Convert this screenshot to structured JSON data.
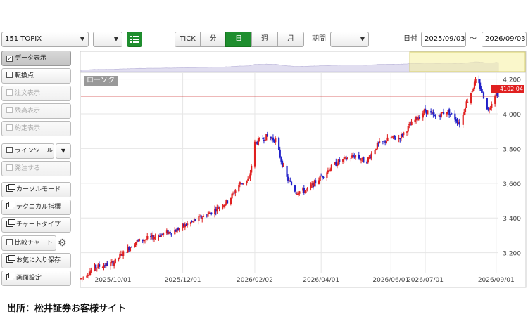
{
  "toolbar": {
    "symbol_value": "151 TOPIX",
    "secondary_select_value": "",
    "list_icon": "list-icon",
    "interval_buttons": [
      "TICK",
      "分",
      "日",
      "週",
      "月"
    ],
    "active_interval": "日",
    "period_label": "期間",
    "period_value": "",
    "date_label": "日付",
    "date_from": "2025/09/03",
    "date_separator": "～",
    "date_to": "2026/09/03"
  },
  "sidebar": {
    "items": [
      {
        "label": "データ表示",
        "kind": "check",
        "checked": true,
        "enabled": true
      },
      {
        "label": "転換点",
        "kind": "check",
        "checked": false,
        "enabled": true
      },
      {
        "label": "注文表示",
        "kind": "check",
        "checked": false,
        "enabled": false
      },
      {
        "label": "残高表示",
        "kind": "check",
        "checked": false,
        "enabled": false
      },
      {
        "label": "約定表示",
        "kind": "check",
        "checked": false,
        "enabled": false
      },
      {
        "label": "ラインツール",
        "kind": "check-dropdown",
        "checked": false,
        "enabled": true
      },
      {
        "label": "発注する",
        "kind": "check",
        "checked": false,
        "enabled": false
      },
      {
        "label": "カーソルモード",
        "kind": "window",
        "enabled": true
      },
      {
        "label": "テクニカル指標",
        "kind": "window",
        "enabled": true
      },
      {
        "label": "チャートタイプ",
        "kind": "window",
        "enabled": true
      },
      {
        "label": "比較チャート",
        "kind": "check-gear",
        "checked": false,
        "enabled": true
      },
      {
        "label": "お気に入り保存",
        "kind": "window",
        "enabled": true
      },
      {
        "label": "画面設定",
        "kind": "window",
        "enabled": true
      }
    ]
  },
  "chart_label": "ローソク",
  "current_price_label": "4102.04",
  "colors": {
    "up": "#e02020",
    "down": "#2020c8",
    "price_line": "#d04040",
    "price_tag": "#e02020",
    "active": "#1e8e2e"
  },
  "caption": "出所：松井証券お客様サイト",
  "chart_data": {
    "type": "candlestick",
    "xlabels": [
      "2025/10/01",
      "2025/12/01",
      "2026/02/02",
      "2026/04/01",
      "2026/06/01",
      "2026/07/01",
      "2026/09/01"
    ],
    "xlabel_dates": [
      "2025-10-01",
      "2025-12-01",
      "2026-02-02",
      "2026-04-01",
      "2026-06-01",
      "2026-07-01",
      "2026-09-01"
    ],
    "x_range": [
      "2025-09-03",
      "2026-09-03"
    ],
    "yticks": [
      3200,
      3400,
      3600,
      3800,
      4000,
      4200
    ],
    "ylim": [
      3085,
      4235
    ],
    "current_price": 4102.04,
    "grid": true,
    "anchors": [
      [
        "2025-09-03",
        3050
      ],
      [
        "2025-09-15",
        3115
      ],
      [
        "2025-10-01",
        3140
      ],
      [
        "2025-10-20",
        3260
      ],
      [
        "2025-11-05",
        3290
      ],
      [
        "2025-11-25",
        3330
      ],
      [
        "2025-12-10",
        3380
      ],
      [
        "2025-12-25",
        3430
      ],
      [
        "2026-01-10",
        3500
      ],
      [
        "2026-01-20",
        3600
      ],
      [
        "2026-01-28",
        3620
      ],
      [
        "2026-02-02",
        3830
      ],
      [
        "2026-02-12",
        3870
      ],
      [
        "2026-02-20",
        3850
      ],
      [
        "2026-03-01",
        3640
      ],
      [
        "2026-03-10",
        3550
      ],
      [
        "2026-03-20",
        3560
      ],
      [
        "2026-04-01",
        3640
      ],
      [
        "2026-04-15",
        3720
      ],
      [
        "2026-05-01",
        3760
      ],
      [
        "2026-05-10",
        3720
      ],
      [
        "2026-05-20",
        3820
      ],
      [
        "2026-06-01",
        3860
      ],
      [
        "2026-06-08",
        3860
      ],
      [
        "2026-06-20",
        3950
      ],
      [
        "2026-07-01",
        4020
      ],
      [
        "2026-07-10",
        3980
      ],
      [
        "2026-07-20",
        4020
      ],
      [
        "2026-08-01",
        3940
      ],
      [
        "2026-08-05",
        4050
      ],
      [
        "2026-08-15",
        4200
      ],
      [
        "2026-08-20",
        4120
      ],
      [
        "2026-08-25",
        4020
      ],
      [
        "2026-09-01",
        4130
      ],
      [
        "2026-09-03",
        4102
      ]
    ]
  }
}
